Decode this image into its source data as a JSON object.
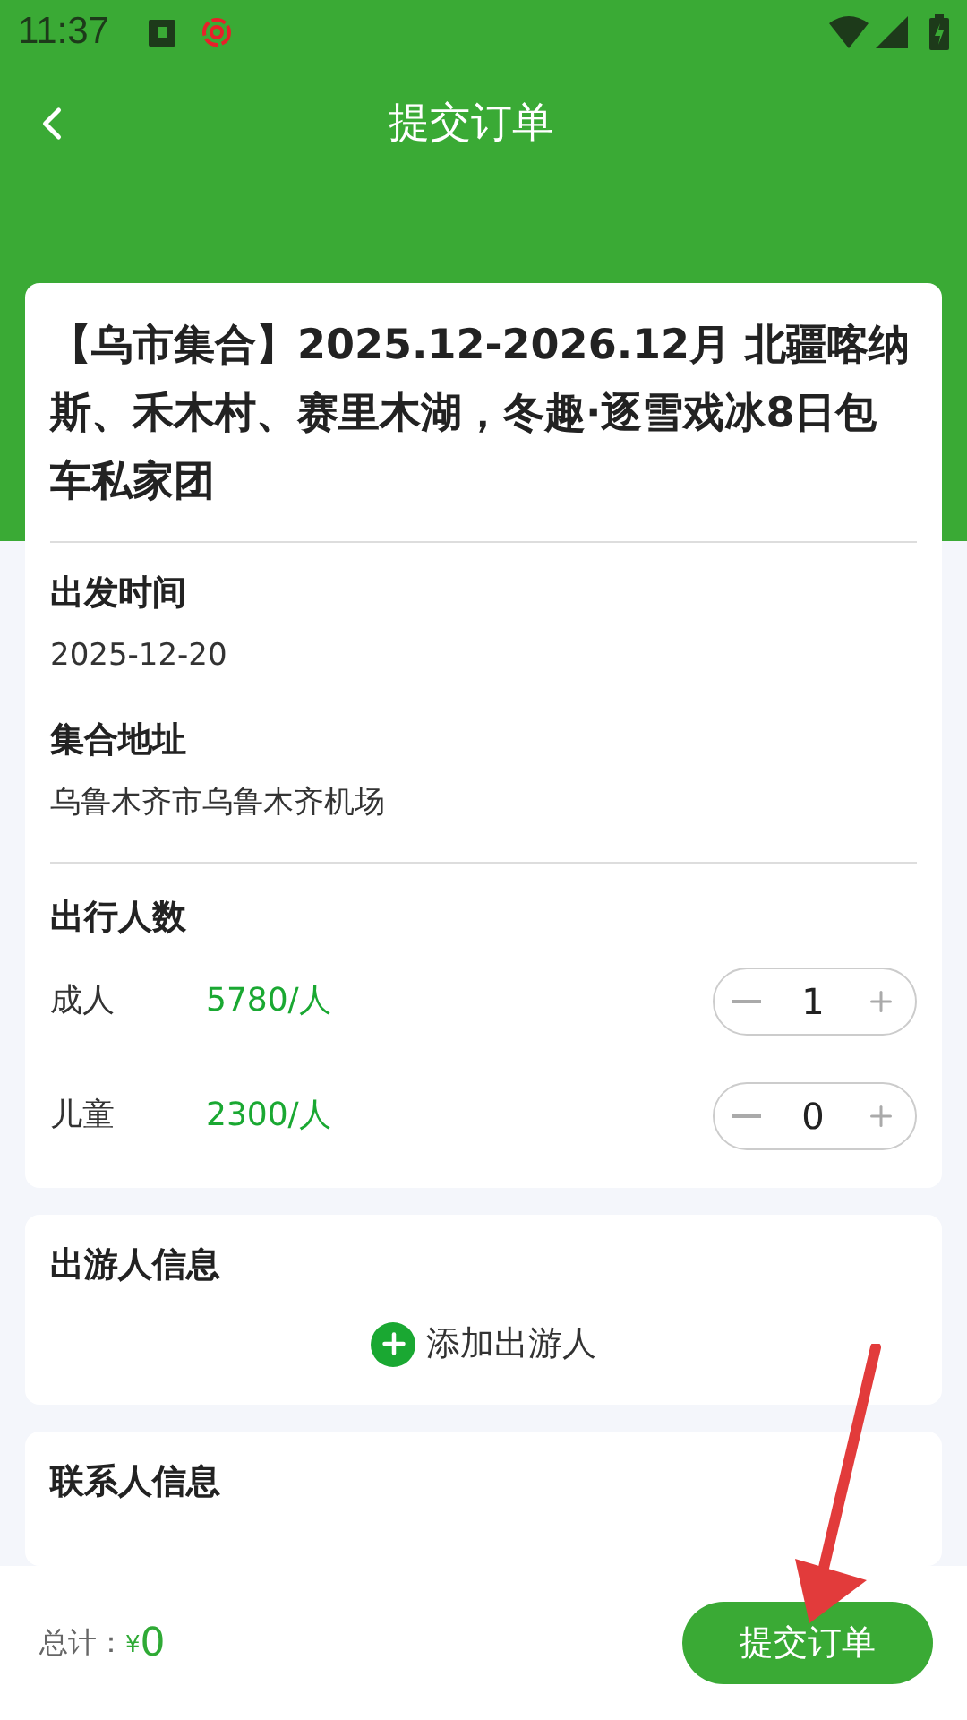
{
  "status_bar": {
    "time": "11:37"
  },
  "nav": {
    "title": "提交订单"
  },
  "product": {
    "title": "【乌市集合】2025.12-2026.12月 北疆喀纳斯、禾木村、赛里木湖，冬趣·逐雪戏冰8日包车私家团"
  },
  "details": [
    {
      "label": "出发时间",
      "value": "2025-12-20"
    },
    {
      "label": "集合地址",
      "value": "乌鲁木齐市乌鲁木齐机场"
    }
  ],
  "travelers": {
    "title": "出行人数",
    "rows": [
      {
        "label": "成人",
        "price": "5780/人",
        "count": "1"
      },
      {
        "label": "儿童",
        "price": "2300/人",
        "count": "0"
      }
    ]
  },
  "tourist_info": {
    "title": "出游人信息",
    "add_button": "添加出游人"
  },
  "contact_info": {
    "title": "联系人信息"
  },
  "footer": {
    "total_label": "总计：",
    "currency": "¥",
    "amount": "0",
    "submit": "提交订单"
  }
}
